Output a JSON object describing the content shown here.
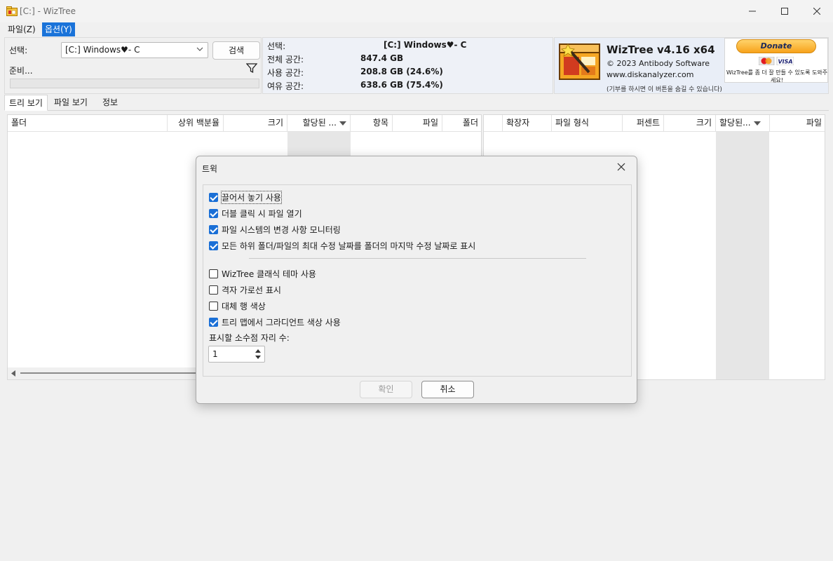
{
  "window": {
    "title": "[C:]  - WizTree"
  },
  "menu": {
    "items": [
      "파일(Z)",
      "옵션(Y)"
    ]
  },
  "select_panel": {
    "select_label": "선택:",
    "drive_value": "[C:] Windows♥- C",
    "search_button": "검색",
    "status": "준비..."
  },
  "info_panel": {
    "rows": [
      {
        "label": "선택:",
        "value": "[C:]   Windows♥- C"
      },
      {
        "label": "전체 공간:",
        "value": "847.4 GB"
      },
      {
        "label": "사용 공간:",
        "value": "208.8 GB  (24.6%)"
      },
      {
        "label": "여유 공간:",
        "value": "638.6 GB  (75.4%)"
      }
    ]
  },
  "brand": {
    "title": "WizTree v4.16 x64",
    "copyright": "© 2023 Antibody Software",
    "website": "www.diskanalyzer.com",
    "note": "(기부를 하시면 이 버튼을 숨길 수 있습니다)",
    "donate_label": "Donate",
    "donate_text": "WizTree를 좀 더 잘 만들 수 있도록 도와주세요!"
  },
  "tabs": [
    "트리 보기",
    "파일 보기",
    "정보"
  ],
  "tree_table": {
    "columns": [
      "폴더",
      "상위 백분율",
      "크기",
      "할당된 ...",
      "항목",
      "파일",
      "폴더"
    ]
  },
  "ext_table": {
    "columns": [
      "",
      "확장자",
      "파일 형식",
      "퍼센트",
      "크기",
      "할당된...",
      "파일"
    ]
  },
  "dialog": {
    "title": "트윅",
    "checkboxes_top": [
      {
        "label": "끌어서 놓기 사용",
        "checked": true
      },
      {
        "label": "더블 클릭 시 파일 열기",
        "checked": true
      },
      {
        "label": "파일 시스템의 변경 사항 모니터링",
        "checked": true
      },
      {
        "label": "모든 하위 폴더/파일의 최대 수정 날짜를 폴더의 마지막 수정 날짜로 표시",
        "checked": true
      }
    ],
    "checkboxes_bottom": [
      {
        "label": "WizTree 클래식 테마 사용",
        "checked": false
      },
      {
        "label": "격자 가로선 표시",
        "checked": false
      },
      {
        "label": "대체 행 색상",
        "checked": false
      },
      {
        "label": "트리 맵에서 그라디언트 색상 사용",
        "checked": true
      }
    ],
    "decimal_label": "표시할 소수점 자리 수:",
    "decimal_value": "1",
    "ok_button": "확인",
    "cancel_button": "취소"
  }
}
